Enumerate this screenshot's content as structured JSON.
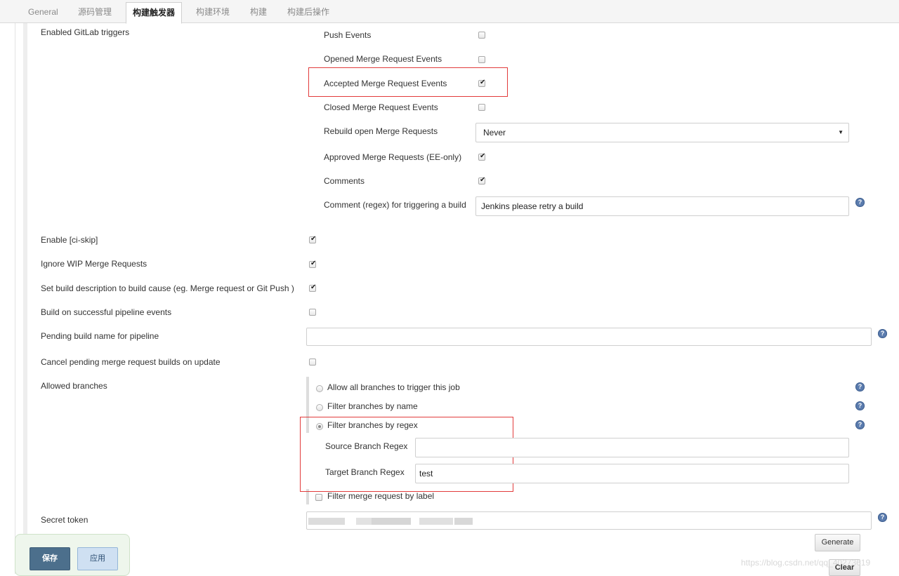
{
  "tabs": [
    {
      "label": "General",
      "active": false
    },
    {
      "label": "源码管理",
      "active": false
    },
    {
      "label": "构建触发器",
      "active": true
    },
    {
      "label": "构建环境",
      "active": false
    },
    {
      "label": "构建",
      "active": false
    },
    {
      "label": "构建后操作",
      "active": false
    }
  ],
  "gitlab": {
    "section_label": "Enabled GitLab triggers",
    "push_events": {
      "label": "Push Events",
      "checked": false
    },
    "opened_mr": {
      "label": "Opened Merge Request Events",
      "checked": false
    },
    "accepted_mr": {
      "label": "Accepted Merge Request Events",
      "checked": true
    },
    "closed_mr": {
      "label": "Closed Merge Request Events",
      "checked": false
    },
    "rebuild_open": {
      "label": "Rebuild open Merge Requests",
      "value": "Never"
    },
    "approved_mr": {
      "label": "Approved Merge Requests (EE-only)",
      "checked": true
    },
    "comments": {
      "label": "Comments",
      "checked": true
    },
    "comment_regex": {
      "label": "Comment (regex) for triggering a build",
      "value": "Jenkins please retry a build"
    }
  },
  "options": {
    "ci_skip": {
      "label": "Enable [ci-skip]",
      "checked": true
    },
    "ignore_wip": {
      "label": "Ignore WIP Merge Requests",
      "checked": true
    },
    "build_description": {
      "label": "Set build description to build cause (eg. Merge request or Git Push )",
      "checked": true
    },
    "pipeline_events": {
      "label": "Build on successful pipeline events",
      "checked": false
    },
    "pending_build_name": {
      "label": "Pending build name for pipeline",
      "value": ""
    },
    "cancel_pending": {
      "label": "Cancel pending merge request builds on update",
      "checked": false
    }
  },
  "branches": {
    "label": "Allowed branches",
    "allow_all": "Allow all branches to trigger this job",
    "filter_by_name": "Filter branches by name",
    "filter_by_regex": "Filter branches by regex",
    "selected": "filter_by_regex",
    "source_regex_label": "Source Branch Regex",
    "source_regex_value": "",
    "target_regex_label": "Target Branch Regex",
    "target_regex_value": "test",
    "filter_by_label": "Filter merge request by label"
  },
  "secret": {
    "label": "Secret token",
    "generate_label": "Generate",
    "clear_label": "Clear"
  },
  "footer": {
    "save_label": "保存",
    "apply_label": "应用"
  },
  "watermark": "https://blog.csdn.net/qq_40273619",
  "icons": {
    "help": "question-circle-icon",
    "check": "check-icon",
    "dropdown": "caret-down-icon"
  },
  "colors": {
    "highlight": "#e23b3b",
    "help": "#5b7cae",
    "save": "#4c6f8c",
    "apply": "#cfe0f2"
  }
}
